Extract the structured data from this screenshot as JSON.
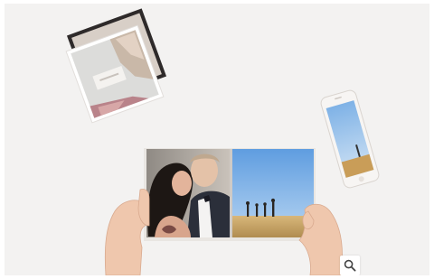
{
  "image": {
    "alt": "",
    "contents": [
      "photo-book",
      "photo-prints",
      "smartphone",
      "hands"
    ]
  },
  "controls": {
    "zoom_icon": "magnifier-icon"
  },
  "colors": {
    "backdrop": "#f3f2f1",
    "sky": "#7fb2e6",
    "field": "#c9a56a"
  }
}
